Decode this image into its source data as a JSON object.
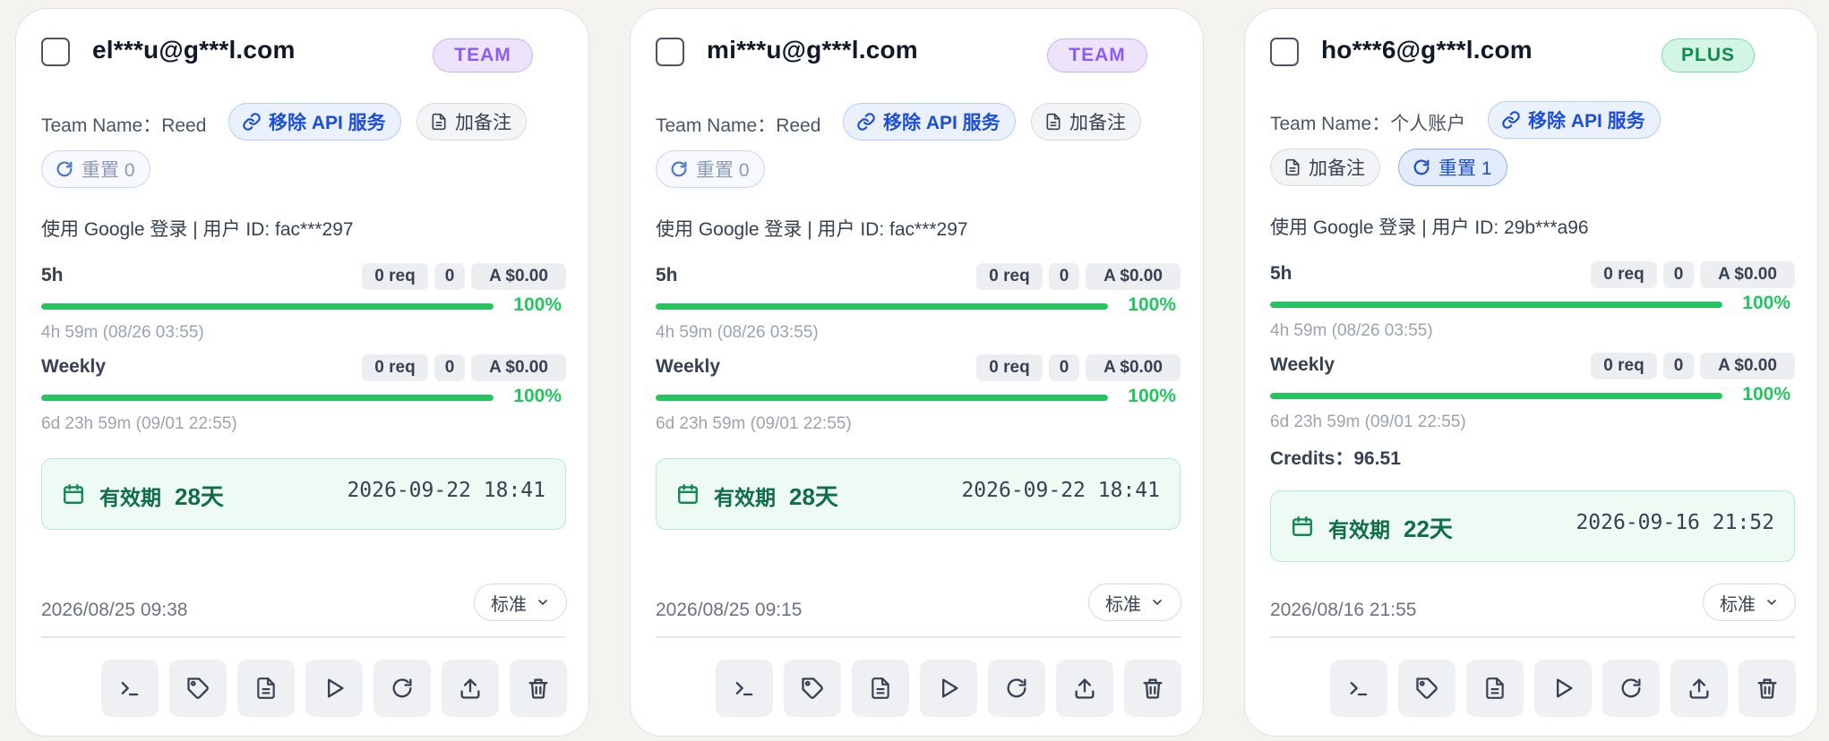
{
  "colors": {
    "team_accent": "#8b5cf6",
    "plus_accent": "#0f8a55",
    "progress_green": "#22c55e",
    "api_blue": "#1d4ed8",
    "validity_green": "#0f6e48"
  },
  "cards": [
    {
      "email": "el***u@g***l.com",
      "plan": "TEAM",
      "team_label": "Team Name：Reed",
      "remove_api_label": "移除 API 服务",
      "note_label": "加备注",
      "reset_label": "重置 0",
      "login_info": "使用 Google 登录 | 用户 ID: fac***297",
      "quota_5h": {
        "label": "5h",
        "req": "0 req",
        "count": "0",
        "cost": "A $0.00",
        "percent": "100%",
        "percent_value": 100,
        "reset": "4h 59m (08/26 03:55)"
      },
      "quota_weekly": {
        "label": "Weekly",
        "req": "0 req",
        "count": "0",
        "cost": "A $0.00",
        "percent": "100%",
        "percent_value": 100,
        "reset": "6d 23h 59m (09/01 22:55)"
      },
      "validity_label": "有效期",
      "validity_days": "28天",
      "validity_date": "2026-09-22 18:41",
      "created": "2026/08/25 09:38",
      "select_value": "标准"
    },
    {
      "email": "mi***u@g***l.com",
      "plan": "TEAM",
      "team_label": "Team Name：Reed",
      "remove_api_label": "移除 API 服务",
      "note_label": "加备注",
      "reset_label": "重置 0",
      "login_info": "使用 Google 登录 | 用户 ID: fac***297",
      "quota_5h": {
        "label": "5h",
        "req": "0 req",
        "count": "0",
        "cost": "A $0.00",
        "percent": "100%",
        "percent_value": 100,
        "reset": "4h 59m (08/26 03:55)"
      },
      "quota_weekly": {
        "label": "Weekly",
        "req": "0 req",
        "count": "0",
        "cost": "A $0.00",
        "percent": "100%",
        "percent_value": 100,
        "reset": "6d 23h 59m (09/01 22:55)"
      },
      "validity_label": "有效期",
      "validity_days": "28天",
      "validity_date": "2026-09-22 18:41",
      "created": "2026/08/25 09:15",
      "select_value": "标准"
    },
    {
      "email": "ho***6@g***l.com",
      "plan": "PLUS",
      "team_label": "Team Name：个人账户",
      "remove_api_label": "移除 API 服务",
      "note_label": "加备注",
      "reset_label": "重置 1",
      "login_info": "使用 Google 登录 | 用户 ID: 29b***a96",
      "quota_5h": {
        "label": "5h",
        "req": "0 req",
        "count": "0",
        "cost": "A $0.00",
        "percent": "100%",
        "percent_value": 100,
        "reset": "4h 59m (08/26 03:55)"
      },
      "quota_weekly": {
        "label": "Weekly",
        "req": "0 req",
        "count": "0",
        "cost": "A $0.00",
        "percent": "100%",
        "percent_value": 100,
        "reset": "6d 23h 59m (09/01 22:55)"
      },
      "credits": "Credits：96.51",
      "validity_label": "有效期",
      "validity_days": "22天",
      "validity_date": "2026-09-16 21:52",
      "created": "2026/08/16 21:55",
      "select_value": "标准"
    }
  ]
}
